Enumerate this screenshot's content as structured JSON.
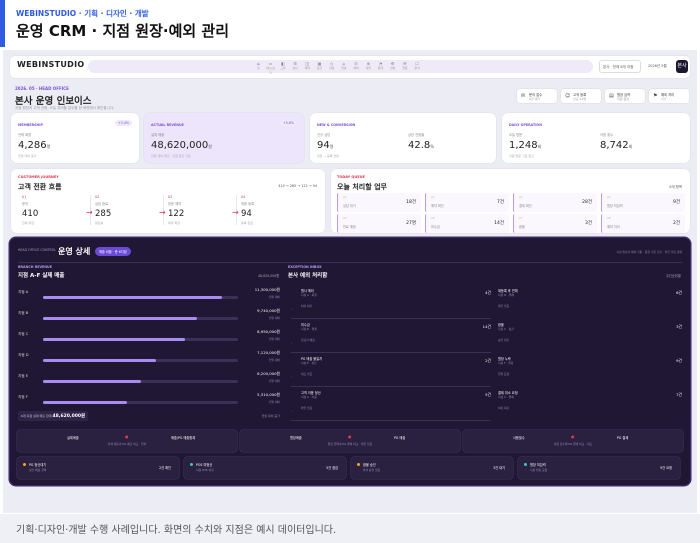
{
  "header": {
    "breadcrumb": "WEBINSTUDIO · 기획 · 디자인 · 개발",
    "title": "운영 CRM · 지점 원장·예외 관리"
  },
  "footer": "기획·디자인·개발 수행 사례입니다. 화면의 수치와 지점은 예시 데이터입니다.",
  "nav": {
    "logo": "WEBINSTUDIO",
    "items": [
      {
        "glyph": "⌂",
        "text": "홈"
      },
      {
        "glyph": "▭",
        "text": "대시 보드"
      },
      {
        "glyph": "◧",
        "text": "고객"
      },
      {
        "glyph": "☰",
        "text": "상담"
      },
      {
        "glyph": "◫",
        "text": "예약"
      },
      {
        "glyph": "▦",
        "text": "정산"
      },
      {
        "glyph": "◇",
        "text": "지점"
      },
      {
        "glyph": "⌂",
        "text": "원장"
      },
      {
        "glyph": "☷",
        "text": "예외"
      },
      {
        "glyph": "⊕",
        "text": "직원"
      },
      {
        "glyph": "◔",
        "text": "통계"
      },
      {
        "glyph": "⚙",
        "text": "설정"
      },
      {
        "glyph": "✉",
        "text": "알림"
      },
      {
        "glyph": "☐",
        "text": "문서"
      }
    ],
    "branch_select": "본사 · 전체 6개 지점",
    "date": "2026년 5월",
    "user_button": "본사"
  },
  "biz": {
    "small": "2026. 05 · HEAD OFFICE",
    "title": "본사 운영 인보이스",
    "subtitle": "지점 원장과 고객 전환, 오늘 처리할 업무를 한 화면에서 확인합니다.",
    "quick": [
      {
        "icon": "✉",
        "a": "문의 접수",
        "b": "6건 대기"
      },
      {
        "icon": "☺",
        "a": "고객 등록",
        "b": "신규 12명"
      },
      {
        "icon": "▤",
        "a": "원장 입력",
        "b": "지점 원장"
      },
      {
        "icon": "⚑",
        "a": "예외 처리",
        "b": "7건"
      }
    ]
  },
  "kpis": [
    {
      "tag": "MEMBERSHIP",
      "badge": "+3.4%",
      "label": "전체 회원",
      "value": "4,286",
      "unit": "명",
      "sub": "전월 대비 증가"
    },
    {
      "tag": "ACTUAL REVENUE",
      "badge": "+5.8%",
      "label": "실제 매출",
      "value": "48,620,000",
      "unit": "원",
      "sub": "전월 대비 매출 · 지점 합산 기준"
    },
    {
      "tag": "NEW & CONVERSION",
      "label": "신규 상담",
      "value": "94",
      "unit": "명",
      "label2": "상담 전환율",
      "value2": "42.8",
      "unit2": "%",
      "sub": "상담 → 등록 전환"
    },
    {
      "tag": "DAILY OPERATION",
      "label": "오늘 방문",
      "value": "1,248",
      "unit": "회",
      "label2": "이용 횟수",
      "value2": "8,742",
      "unit2": "회",
      "sub": "지점 방문 기준 합산"
    }
  ],
  "journey": {
    "tag": "CUSTOMER JOURNEY",
    "title": "고객 전환 흐름",
    "meta": "410 → 285 → 122 → 94",
    "stages": [
      {
        "num": "01",
        "label": "문의",
        "value": "410",
        "sub": "전체 유입"
      },
      {
        "num": "02",
        "label": "상담 완료",
        "value": "285",
        "sub": "응답률"
      },
      {
        "num": "03",
        "label": "방문 예약",
        "value": "122",
        "sub": "예약 확정"
      },
      {
        "num": "04",
        "label": "최종 등록",
        "value": "94",
        "sub": "등록 완료"
      }
    ]
  },
  "today": {
    "tag": "TODAY QUEUE",
    "title": "오늘 처리할 업무",
    "count": "6개 항목",
    "tiles": [
      {
        "small": "01",
        "label": "상담 대기",
        "value": "18건"
      },
      {
        "small": "02",
        "label": "예약 확인",
        "value": "7건"
      },
      {
        "small": "03",
        "label": "결제 확인",
        "value": "28건"
      },
      {
        "small": "04",
        "label": "원장 미입력",
        "value": "9건"
      },
      {
        "small": "05",
        "label": "만료 예정",
        "value": "27명"
      },
      {
        "small": "06",
        "label": "미수금",
        "value": "14건"
      },
      {
        "small": "07",
        "label": "환불",
        "value": "3건"
      },
      {
        "small": "08",
        "label": "예외 처리",
        "value": "2건"
      }
    ]
  },
  "detail": {
    "small": "HEAD OFFICE CONTROL",
    "title": "운영 상세",
    "pill": "매출 비율 · 총 6지점",
    "note": "지점 원장과 예외 현황 · 동일 기준 합산 · 확인 필요 항목",
    "branch": {
      "tag": "BRANCH REVENUE",
      "title": "지점 A-F 실제 매출",
      "right": "48,620,000원",
      "rows": [
        {
          "name": "지점 A",
          "value": "11,300,000원",
          "sub": "전월 대비",
          "pct": 0.92
        },
        {
          "name": "지점 B",
          "value": "9,740,000원",
          "sub": "전월 대비",
          "pct": 0.79
        },
        {
          "name": "지점 C",
          "value": "8,950,000원",
          "sub": "전월 대비",
          "pct": 0.73
        },
        {
          "name": "지점 D",
          "value": "7,120,000원",
          "sub": "전월 대비",
          "pct": 0.58
        },
        {
          "name": "지점 E",
          "value": "6,200,000원",
          "sub": "전월 대비",
          "pct": 0.5
        },
        {
          "name": "지점 F",
          "value": "5,310,000원",
          "sub": "전월 대비",
          "pct": 0.43
        }
      ],
      "total_label": "6개 지점 실제 매출 합계",
      "total_value": "48,620,000원",
      "total_right": "전월 대비 증가"
    },
    "exceptions": {
      "tag": "EXCEPTION INBOX",
      "title": "본사 예외 처리함",
      "right": "우선순위별",
      "items": [
        {
          "a": "원사 예외",
          "b": "지점 A · 회원",
          "c": "처리 대기",
          "v": "4건"
        },
        {
          "a": "재등록 후 연체",
          "b": "지점 D · 결제",
          "c": "확인 필요",
          "v": "6건"
        },
        {
          "a": "미수금",
          "b": "지점 B · 결제",
          "c": "담당자 배정",
          "v": "14건"
        },
        {
          "a": "환불",
          "b": "지점 C · 정산",
          "c": "승인 대기",
          "v": "3건"
        },
        {
          "a": "PG 매출 불일치",
          "b": "지점 E · 정산",
          "c": "대조 필요",
          "v": "2건"
        },
        {
          "a": "원장 누락",
          "b": "지점 F · 원장",
          "c": "입력 요청",
          "v": "9건"
        },
        {
          "a": "고객 이용 정산",
          "b": "지점 A · 이용",
          "c": "확인 필요",
          "v": "5건"
        },
        {
          "a": "결제 취소 요청",
          "b": "지점 C · 결제",
          "c": "처리 대기",
          "v": "7건"
        }
      ]
    },
    "panels": [
      {
        "left": "실제매출",
        "right": "매출/PG 매출합계",
        "sub": "실제 매출과 PG 매출 비교 · 일치"
      },
      {
        "left": "원장매출",
        "right": "PG 매출",
        "sub": "원장 입력과 PG 결제 비교 · 확인 필요"
      },
      {
        "left": "사용횟수",
        "right": "PG 결제",
        "sub": "이용 횟수와 PG 결제 비교 · 대조"
      }
    ],
    "footer_items": [
      {
        "a": "PG 정산대기",
        "s": "정산 예정 금액",
        "v": "2건 확인",
        "dot": "#f5a623"
      },
      {
        "a": "POS 미정산",
        "s": "지점 POS 마감",
        "v": "5건 점검",
        "dot": "#39c5cf"
      },
      {
        "a": "환불 승인",
        "s": "본사 승인 필요",
        "v": "3건 대기",
        "dot": "#f5a623"
      },
      {
        "a": "원장 미입력",
        "s": "지점 원장 요청",
        "v": "9건 요청",
        "dot": "#39c5cf"
      }
    ]
  }
}
